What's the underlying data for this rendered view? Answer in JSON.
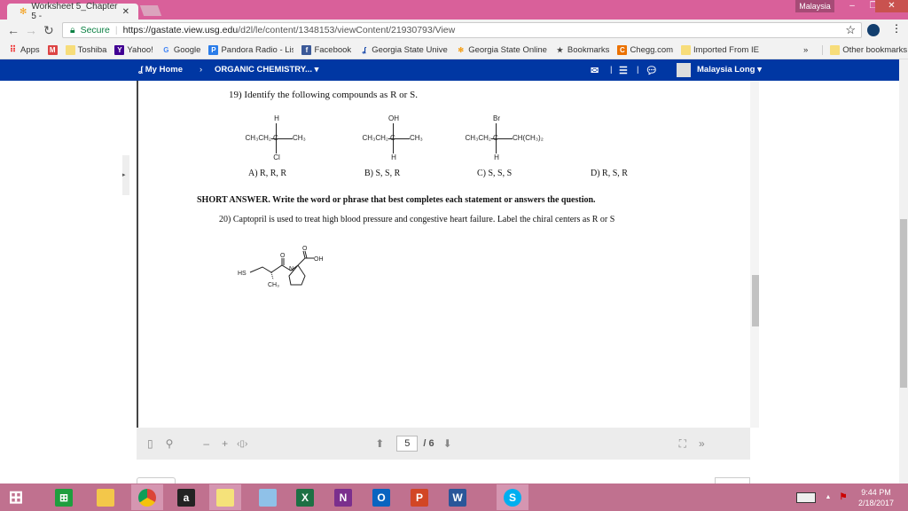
{
  "browser": {
    "tab_title": "Worksheet 5_Chapter 5 -",
    "profile": "Malaysia",
    "secure": "Secure",
    "url_host": "https://gastate.view.usg.edu",
    "url_path": "/d2l/le/content/1348153/viewContent/21930793/View"
  },
  "bookmarks": [
    {
      "label": "Apps",
      "icon": "apps-grid-icon"
    },
    {
      "label": "",
      "icon": "gmail-icon"
    },
    {
      "label": "Toshiba",
      "icon": "folder-icon"
    },
    {
      "label": "Yahoo!",
      "icon": "yahoo-icon"
    },
    {
      "label": "Google",
      "icon": "google-icon"
    },
    {
      "label": "Pandora Radio - Listen",
      "icon": "pandora-icon"
    },
    {
      "label": "Facebook",
      "icon": "facebook-icon"
    },
    {
      "label": "Georgia State Univers",
      "icon": "gsu-icon"
    },
    {
      "label": "Georgia State Online",
      "icon": "gsu-online-icon"
    },
    {
      "label": "Bookmarks",
      "icon": "star-icon"
    },
    {
      "label": "Chegg.com",
      "icon": "chegg-icon"
    },
    {
      "label": "Imported From IE",
      "icon": "folder-icon"
    }
  ],
  "bookmarks_overflow": "»",
  "other_bookmarks": "Other bookmarks",
  "d2l": {
    "home": "My Home",
    "course": "ORGANIC CHEMISTRY...",
    "user": "Malaysia Long"
  },
  "doc": {
    "q19_num": "19)",
    "q19": "Identify the following compounds as R or S.",
    "compounds": [
      {
        "top": "H",
        "left": "CH₃CH₂",
        "center": "C",
        "right": "CH₃",
        "bottom": "Cl"
      },
      {
        "top": "OH",
        "left": "CH₃CH₂",
        "center": "C",
        "right": "CH₃",
        "bottom": "H"
      },
      {
        "top": "Br",
        "left": "CH₃CH₂",
        "center": "C",
        "right": "CH(CH₃)₂",
        "bottom": "H"
      }
    ],
    "options": [
      "A) R, R, R",
      "B) S, S, R",
      "C) S, S, S",
      "D) R, S, R"
    ],
    "short_answer": "SHORT ANSWER.  Write the word or phrase that best completes each statement or answers the question.",
    "q20_num": "20)",
    "q20": "Captopril is used to treat high blood pressure and congestive heart failure.  Label the chiral centers as R or S",
    "captopril": {
      "hs": "HS",
      "o1": "O",
      "o2": "O",
      "oh": "OH",
      "n": "N",
      "ch3": "CH₃"
    }
  },
  "toolbar": {
    "page": "5",
    "total": "/ 6"
  },
  "taskbar": {
    "time": "9:44 PM",
    "date": "2/18/2017",
    "apps": [
      "chrome",
      "amazon",
      "sticky-notes",
      "calculator",
      "excel",
      "onenote",
      "outlook",
      "powerpoint",
      "word",
      "skype"
    ]
  }
}
